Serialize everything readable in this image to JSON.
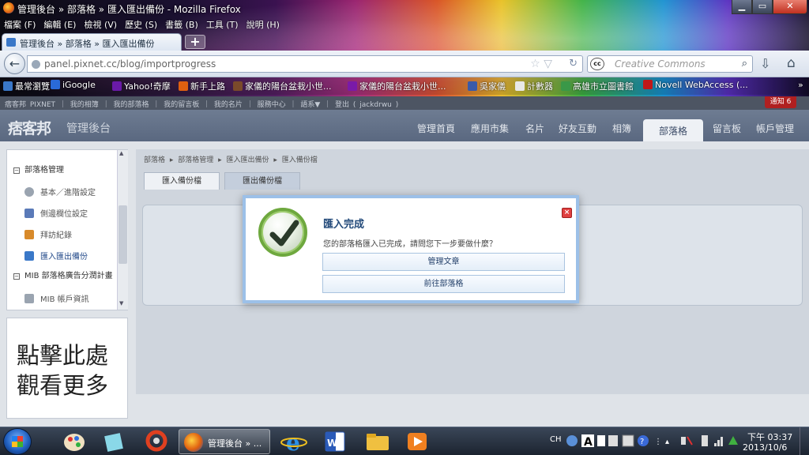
{
  "window": {
    "title": "管理後台 » 部落格 » 匯入匯出備份 - Mozilla Firefox",
    "minimize": "▁",
    "maximize": "▭",
    "close": "✕"
  },
  "menubar": [
    "檔案 (F)",
    "編輯 (E)",
    "檢視 (V)",
    "歷史 (S)",
    "書籤 (B)",
    "工具 (T)",
    "說明 (H)"
  ],
  "tab": {
    "label": "管理後台 » 部落格 » 匯入匯出備份",
    "new_tab": "+"
  },
  "address": {
    "url": "panel.pixnet.cc/blog/importprogress"
  },
  "search": {
    "badge": "cc",
    "placeholder": "Creative Commons"
  },
  "bookmarks": [
    {
      "label": "最常瀏覽",
      "color": "#3a78c8"
    },
    {
      "label": "iGoogle",
      "color": "#2a6ad8"
    },
    {
      "label": "Yahoo!奇摩",
      "color": "#6a1aa8"
    },
    {
      "label": "新手上路",
      "color": "#e06010"
    },
    {
      "label": "家儀的陽台盆栽小世...",
      "color": "#7a4a2a"
    },
    {
      "label": "家儀的陽台盆栽小世...",
      "color": "#7a1aa8"
    },
    {
      "label": "吳家儀",
      "color": "#3a5aa8"
    },
    {
      "label": "計數器",
      "color": "#e8e8e8"
    },
    {
      "label": "高雄市立圖書館",
      "color": "#3a9848"
    },
    {
      "label": "Novell WebAccess (...",
      "color": "#c01818"
    }
  ],
  "bookmarks_more": "»",
  "site": {
    "topstrip": "痞客邦 PIXNET ｜ 我的相簿 ｜ 我的部落格 ｜ 我的留言板 ｜ 我的名片 ｜ 服務中心 ｜ 語系▼ ｜ 登出 ( jackdrwu )",
    "notify": "通知 6",
    "logo": "痞客邦",
    "logo_sub": "管理後台",
    "nav": [
      "管理首頁",
      "應用市集",
      "名片",
      "好友互動",
      "相簿",
      "部落格",
      "留言板",
      "帳戶管理"
    ],
    "nav_active_index": 5
  },
  "sidebar": {
    "section1": {
      "marker": "−",
      "label": "部落格管理"
    },
    "items": [
      {
        "label": "基本／進階設定",
        "color": "#9aa4b0"
      },
      {
        "label": "側邊欄位設定",
        "color": "#5a7ab8"
      },
      {
        "label": "拜訪紀錄",
        "color": "#d88a2a"
      },
      {
        "label": "匯入匯出備份",
        "color": "#3a78c8",
        "active": true
      }
    ],
    "section2": {
      "marker": "−",
      "label": "MIB 部落格廣告分潤計畫"
    },
    "items2": [
      {
        "label": "MIB 帳戶資訊",
        "color": "#9aa4b0"
      }
    ],
    "scroll_up": "▲",
    "scroll_down": "▼"
  },
  "ad": {
    "line1": "點擊此處",
    "line2": "觀看更多"
  },
  "main": {
    "breadcrumb": "部落格 ▸ 部落格管理 ▸ 匯入匯出備份 ▸ 匯入備份檔",
    "tabs": [
      "匯入備份檔",
      "匯出備份檔"
    ]
  },
  "modal": {
    "title": "匯入完成",
    "message": "您的部落格匯入已完成，請問您下一步要做什麼？",
    "close": "×",
    "buttons": [
      "管理文章",
      "前往部落格"
    ],
    "accent": "#6ea83e"
  },
  "taskbar": {
    "active_app": "管理後台 » ...",
    "tray": "CH",
    "time": "下午 03:37",
    "date": "2013/10/6"
  }
}
